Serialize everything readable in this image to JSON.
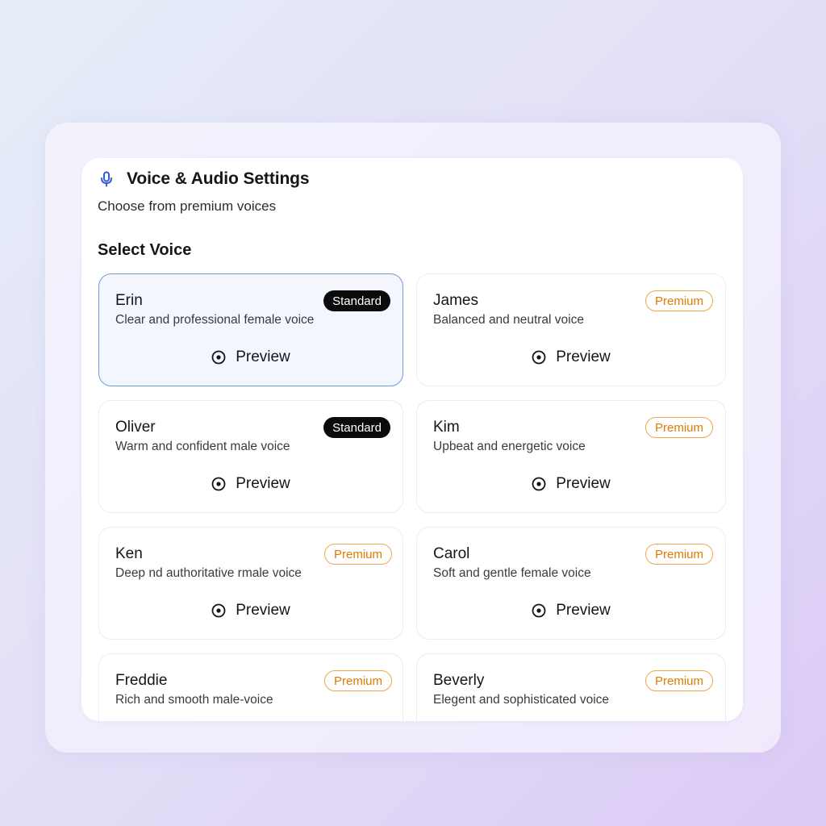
{
  "header": {
    "title": "Voice & Audio Settings",
    "subtitle": "Choose from premium voices",
    "icon": "microphone-icon",
    "accent_color": "#2f5fd0"
  },
  "section": {
    "title": "Select Voice"
  },
  "preview_label": "Preview",
  "badge_colors": {
    "standard_bg": "#0b0b0d",
    "premium_text": "#e07b00"
  },
  "voices": [
    {
      "name": "Erin",
      "description": "Clear and professional female voice",
      "badge": "Standard",
      "tier": "standard",
      "selected": true
    },
    {
      "name": "James",
      "description": "Balanced and neutral voice",
      "badge": "Premium",
      "tier": "premium",
      "selected": false
    },
    {
      "name": "Oliver",
      "description": "Warm and confident male voice",
      "badge": "Standard",
      "tier": "standard",
      "selected": false
    },
    {
      "name": "Kim",
      "description": "Upbeat and energetic voice",
      "badge": "Premium",
      "tier": "premium",
      "selected": false
    },
    {
      "name": "Ken",
      "description": "Deep nd authoritative rmale voice",
      "badge": "Premium",
      "tier": "premium",
      "selected": false
    },
    {
      "name": "Carol",
      "description": "Soft and  gentle female voice",
      "badge": "Premium",
      "tier": "premium",
      "selected": false
    },
    {
      "name": "Freddie",
      "description": "Rich and smooth male-voice",
      "badge": "Premium",
      "tier": "premium",
      "selected": false
    },
    {
      "name": "Beverly",
      "description": "Elegent and sophisticated voice",
      "badge": "Premium",
      "tier": "premium",
      "selected": false
    }
  ]
}
